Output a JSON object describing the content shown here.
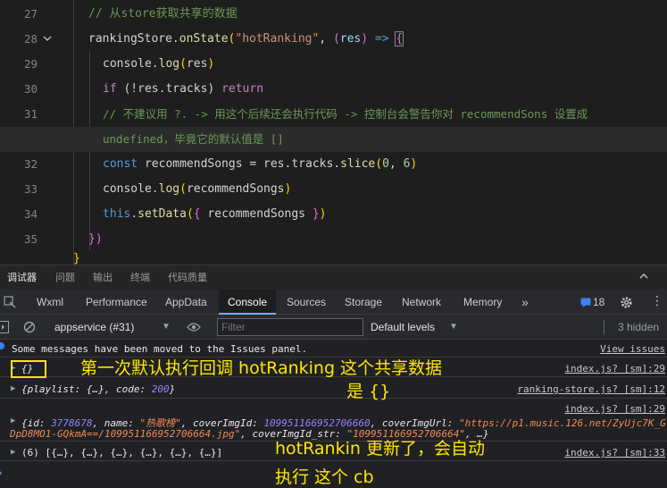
{
  "editor": {
    "lines": [
      {
        "num": "27",
        "text": "// 从store获取共享的数据"
      },
      {
        "num": "28",
        "obj": "rankingStore",
        "method": "onState",
        "str": "\"hotRanking\"",
        "param": "res"
      },
      {
        "num": "29",
        "obj": "console",
        "method": "log",
        "arg": "res"
      },
      {
        "num": "30",
        "kw": "if",
        "cond": "(!res.tracks)",
        "ret": "return"
      },
      {
        "num": "31",
        "text": "// 不建议用 ?. -> 用这个后续还会执行代码 -> 控制台会警告你对 recommendSons 设置成"
      },
      {
        "num": "",
        "text": "undefined，毕竟它的默认值是 []"
      },
      {
        "num": "32",
        "kw": "const",
        "name": "recommendSongs",
        "expr": "res.tracks.",
        "method": "slice",
        "a": "0",
        "b": "6"
      },
      {
        "num": "33",
        "obj": "console",
        "method": "log",
        "arg": "recommendSongs"
      },
      {
        "num": "34",
        "kw": "this",
        "method": "setData",
        "arg": "recommendSongs"
      },
      {
        "num": "35",
        "text": "})"
      }
    ]
  },
  "panel_tabs": [
    "调试器",
    "问题",
    "输出",
    "终端",
    "代码质量"
  ],
  "devtools_tabs": [
    "Wxml",
    "Performance",
    "AppData",
    "Console",
    "Sources",
    "Storage",
    "Network",
    "Memory"
  ],
  "devtools_more": "»",
  "badge_count": "18",
  "toolbar": {
    "context": "appservice (#31)",
    "filter_placeholder": "Filter",
    "levels": "Default levels",
    "hidden": "3 hidden"
  },
  "console": {
    "moved_msg": "Some messages have been moved to the Issues panel.",
    "view_issues": "View issues",
    "rows": [
      {
        "text": "{}",
        "src": "index.js? [sm]:29"
      },
      {
        "text_k1": "{playlist: {…}, code: ",
        "num": "200",
        "text_k2": "}",
        "src": "ranking-store.js? [sm]:12"
      },
      {
        "src": "index.js? [sm]:29",
        "l1_a": "{id: ",
        "l1_id": "3778678",
        "l1_b": ", name: ",
        "l1_name": "\"热歌榜\"",
        "l1_c": ", coverImgId: ",
        "l1_cid": "109951166952706660",
        "l1_d": ", coverImgUrl: ",
        "l1_url": "\"https://p1.music.126.net/ZyUjc7K_G",
        "l2_url": "DpD8MO1-GQkmA==/109951166952706664.jpg\"",
        "l2_a": ", coverImgId_str: ",
        "l2_str": "\"109951166952706664\"",
        "l2_b": ", …}"
      },
      {
        "text": "(6) [{…}, {…}, {…}, {…}, {…}, {…}]",
        "src": "index.js? [sm]:33"
      }
    ]
  },
  "annotations": {
    "a1_line1": "第一次默认执行回调 hotRanking 这个共享数据",
    "a1_line2": "是 {}",
    "a2_line1": "hotRankin 更新了，会自动",
    "a2_line2": "执行 这个 cb"
  },
  "colors": {
    "annotation": "#ffe600",
    "accent": "#7cacf8"
  }
}
